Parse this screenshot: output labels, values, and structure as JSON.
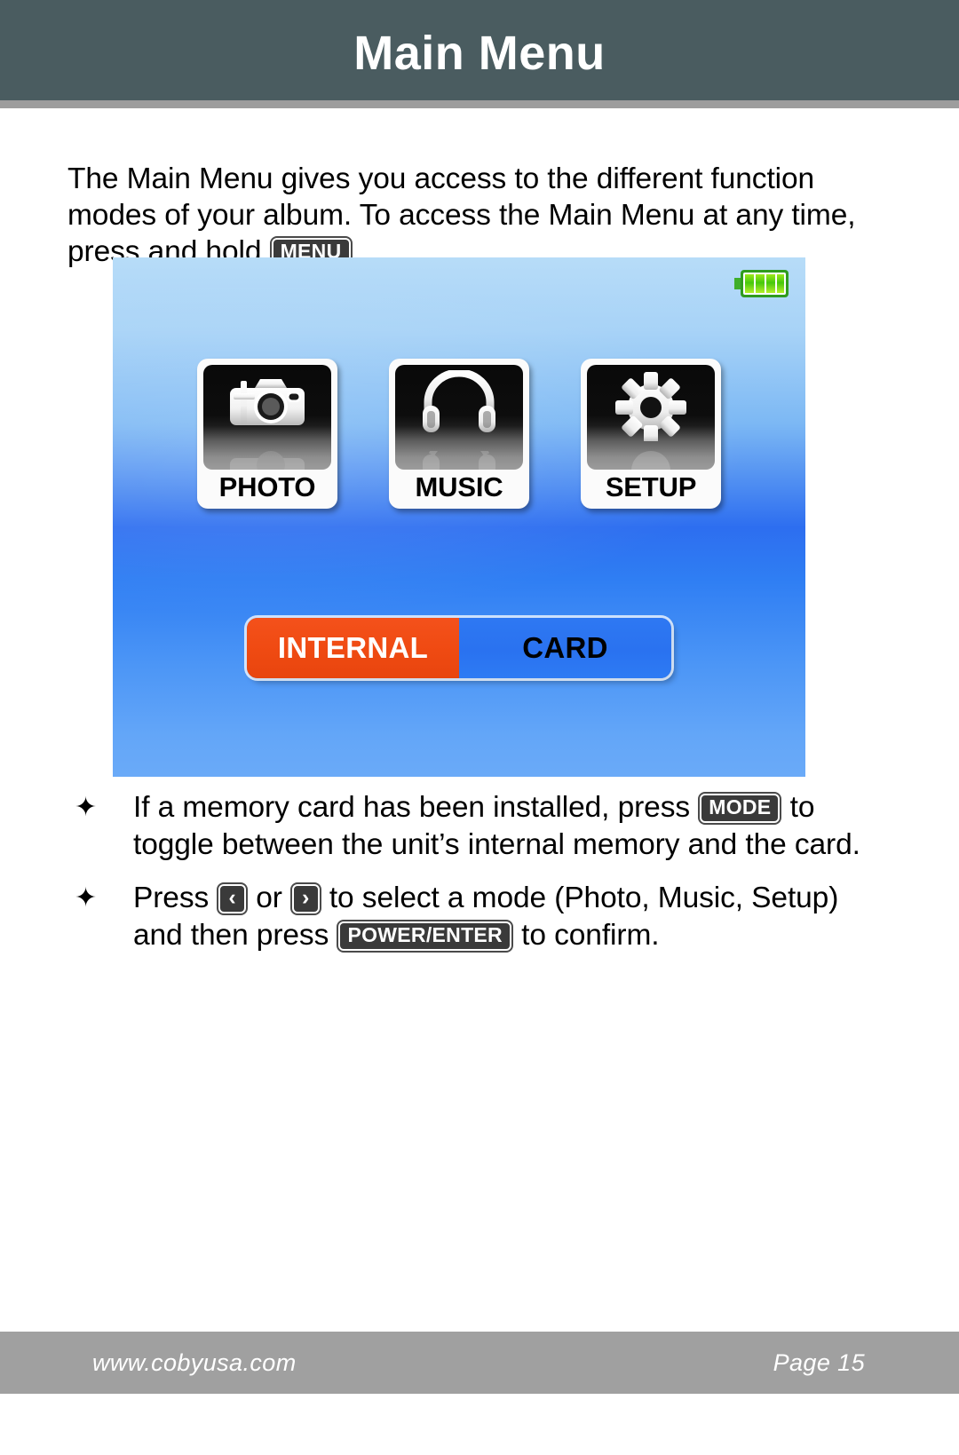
{
  "header": {
    "title": "Main Menu"
  },
  "intro": {
    "part1": "The Main Menu gives you access to the different function modes of your album. To access the Main Menu at any time, press and hold ",
    "key_menu": "MENU",
    "part2": "."
  },
  "device_screen": {
    "battery_icon": "battery-full-icon",
    "battery_segments": 4,
    "tiles": [
      {
        "label": "PHOTO",
        "icon": "camera-icon"
      },
      {
        "label": "MUSIC",
        "icon": "headphones-icon"
      },
      {
        "label": "SETUP",
        "icon": "gear-icon"
      }
    ],
    "storage_toggle": {
      "options": [
        {
          "label": "INTERNAL",
          "state": "active"
        },
        {
          "label": "CARD",
          "state": "inactive"
        }
      ],
      "active_color": "#ef4a12",
      "inactive_color": "#2e78f2"
    }
  },
  "bullets": [
    {
      "mark": "✦",
      "segments": [
        {
          "type": "text",
          "value": "If a memory card has been installed, press "
        },
        {
          "type": "key",
          "value": "MODE"
        },
        {
          "type": "text",
          "value": " to toggle between the unit’s internal memory and the card."
        }
      ]
    },
    {
      "mark": "✦",
      "segments": [
        {
          "type": "text",
          "value": "Press "
        },
        {
          "type": "key",
          "value": "‹"
        },
        {
          "type": "text",
          "value": " or "
        },
        {
          "type": "key",
          "value": "›"
        },
        {
          "type": "text",
          "value": " to select a mode (Photo, Music, Setup) and then press "
        },
        {
          "type": "key",
          "value": "POWER/ENTER"
        },
        {
          "type": "text",
          "value": " to confirm."
        }
      ]
    }
  ],
  "footer": {
    "website": "www.cobyusa.com",
    "page": "Page 15"
  }
}
